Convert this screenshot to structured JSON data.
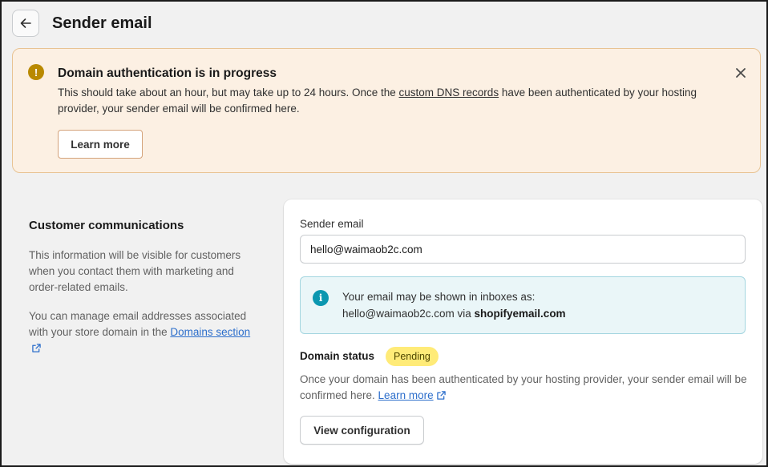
{
  "header": {
    "title": "Sender email",
    "back_icon": "arrow-left-icon"
  },
  "banner": {
    "status": "warning",
    "title": "Domain authentication is in progress",
    "text_before_link": "This should take about an hour, but may take up to 24 hours. Once the ",
    "link_text": "custom DNS records",
    "text_after_link": " have been authenticated by your hosting provider, your sender email will be confirmed here.",
    "button_label": "Learn more",
    "close_icon": "close-icon",
    "colors": {
      "background": "#fcf0e3",
      "border": "#e8c393",
      "icon": "#b98900"
    }
  },
  "section": {
    "title": "Customer communications",
    "description": "This information will be visible for customers when you contact them with marketing and order-related emails.",
    "manage_text": "You can manage email addresses associated with your store domain in the ",
    "domains_link": "Domains section"
  },
  "card": {
    "sender_label": "Sender email",
    "sender_value": "hello@waimaob2c.com",
    "info": {
      "line1": "Your email may be shown in inboxes as:",
      "line2_prefix": "hello@waimaob2c.com via ",
      "line2_bold": "shopifyemail.com",
      "icon": "info-icon"
    },
    "domain_status_label": "Domain status",
    "domain_status_badge": "Pending",
    "status_description": "Once your domain has been authenticated by your hosting provider, your sender email will be confirmed here. ",
    "status_link": "Learn more",
    "config_button": "View configuration",
    "colors": {
      "badge": "#ffeb78",
      "info_bg": "#eaf6f8",
      "link": "#2c6ecb"
    }
  }
}
